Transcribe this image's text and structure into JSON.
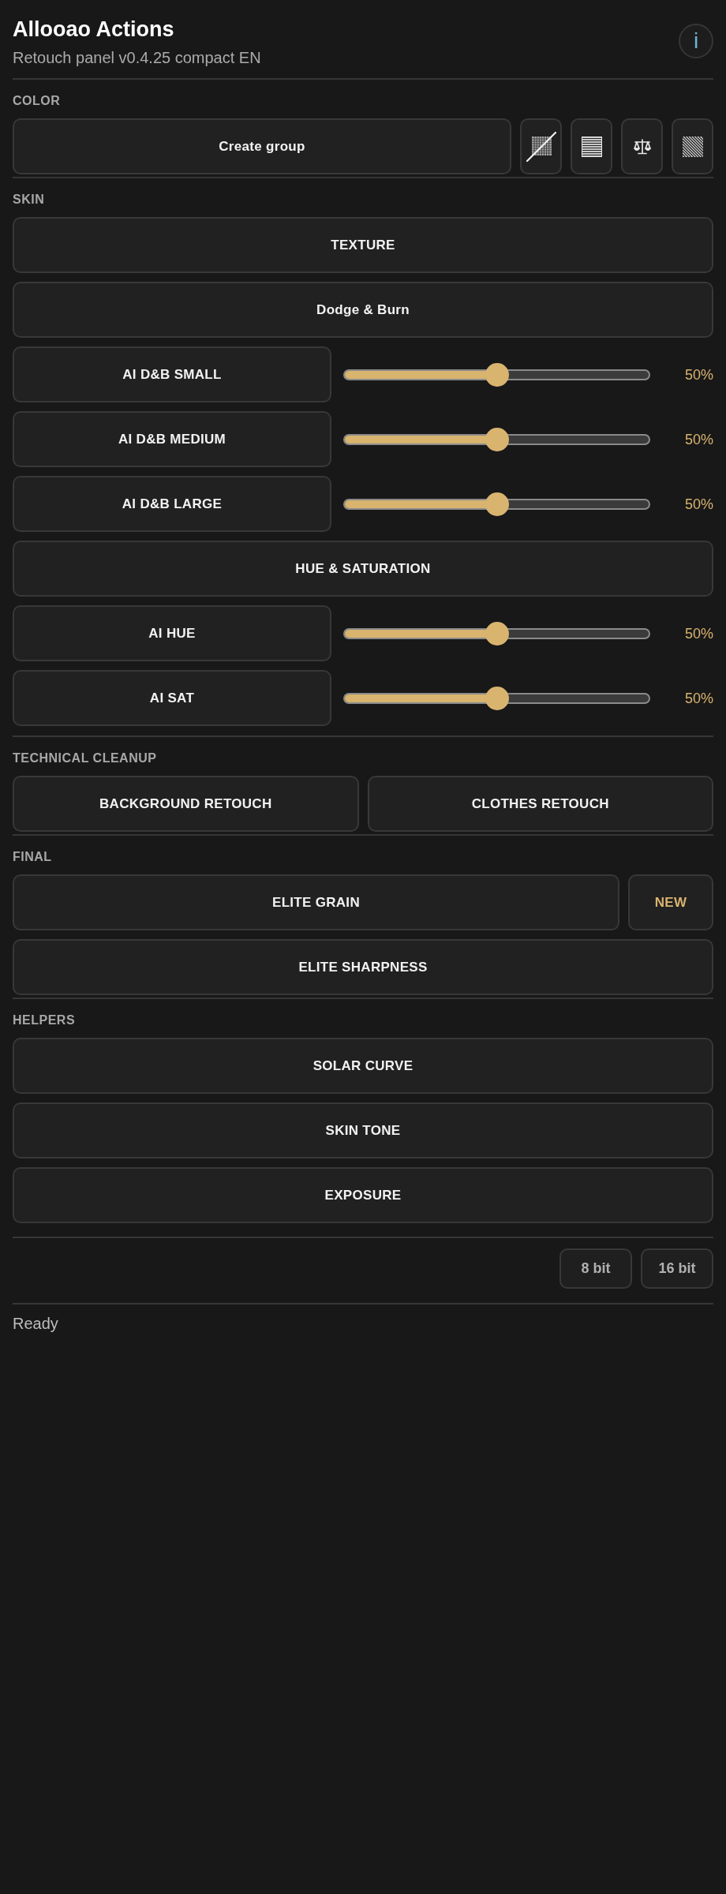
{
  "header": {
    "title": "Allooao Actions",
    "subtitle": "Retouch panel v0.4.25 compact EN",
    "info_button": {
      "label": "i"
    }
  },
  "sections": [
    {
      "label": "COLOR",
      "rows": [
        {
          "kind": "toolbar",
          "label": "Create group"
        }
      ]
    },
    {
      "label": "SKIN",
      "rows": [
        {
          "kind": "button",
          "label": "TEXTURE"
        },
        {
          "kind": "button",
          "label": "Dodge & Burn"
        },
        {
          "kind": "slider",
          "label": "AI D&B SMALL",
          "level": 0.5,
          "reading": "50%"
        },
        {
          "kind": "slider",
          "label": "AI D&B MEDIUM",
          "level": 0.5,
          "reading": "50%"
        },
        {
          "kind": "slider",
          "label": "AI D&B LARGE",
          "level": 0.5,
          "reading": "50%"
        },
        {
          "kind": "button",
          "label": "HUE & SATURATION"
        },
        {
          "kind": "slider",
          "label": "AI HUE",
          "level": 0.5,
          "reading": "50%"
        },
        {
          "kind": "slider",
          "label": "AI SAT",
          "level": 0.5,
          "reading": "50%"
        }
      ]
    },
    {
      "label": "TECHNICAL CLEANUP",
      "rows": [
        {
          "kind": "pair",
          "buttons": [
            "BACKGROUND RETOUCH",
            "CLOTHES RETOUCH"
          ]
        }
      ]
    },
    {
      "label": "FINAL",
      "rows": [
        {
          "kind": "badged",
          "label": "ELITE GRAIN",
          "badge": "NEW"
        },
        {
          "kind": "button",
          "label": "ELITE SHARPNESS"
        }
      ]
    },
    {
      "label": "HELPERS",
      "rows": [
        {
          "kind": "button",
          "label": "SOLAR CURVE"
        },
        {
          "kind": "button",
          "label": "SKIN TONE"
        },
        {
          "kind": "button",
          "label": "EXPOSURE"
        }
      ]
    }
  ],
  "bit_depth": [
    {
      "label": "8 bit"
    },
    {
      "label": "16 bit"
    }
  ],
  "status_bar": {
    "text": "Ready"
  }
}
